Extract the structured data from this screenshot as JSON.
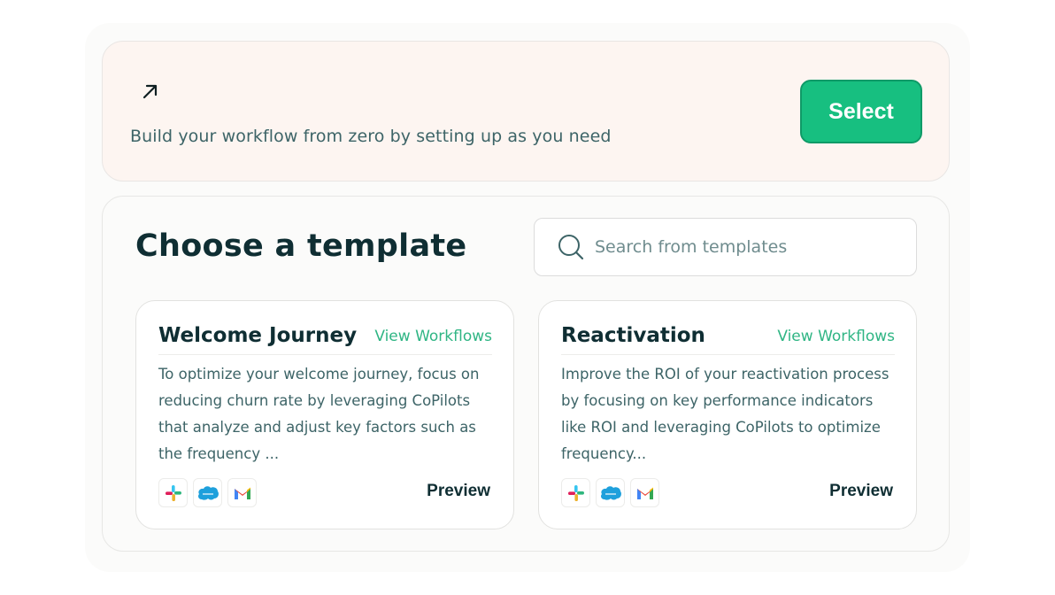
{
  "scratch": {
    "description": "Build your workflow from zero by setting up as you need",
    "select_label": "Select",
    "icon": "arrow-up-right-icon"
  },
  "templates": {
    "title": "Choose a template",
    "search": {
      "placeholder": "Search from templates",
      "value": ""
    },
    "cards": [
      {
        "title": "Welcome Journey",
        "link": "View Workflows",
        "description": "To optimize your welcome journey, focus on reducing churn rate by leveraging CoPilots that analyze and adjust key factors such as the frequency ...",
        "preview": "Preview",
        "apps": [
          "slack-icon",
          "salesforce-icon",
          "gmail-icon"
        ]
      },
      {
        "title": "Reactivation",
        "link": "View Workflows",
        "description": "Improve the ROI of your reactivation process by focusing on key performance indicators like ROI and leveraging CoPilots to optimize frequency...",
        "preview": "Preview",
        "apps": [
          "slack-icon",
          "salesforce-icon",
          "gmail-icon"
        ]
      }
    ]
  },
  "colors": {
    "accent": "#17bf80",
    "link": "#2fb584",
    "heading": "#0f2e33",
    "body_text": "#3d6467",
    "scratch_bg": "#fdf5f1"
  }
}
